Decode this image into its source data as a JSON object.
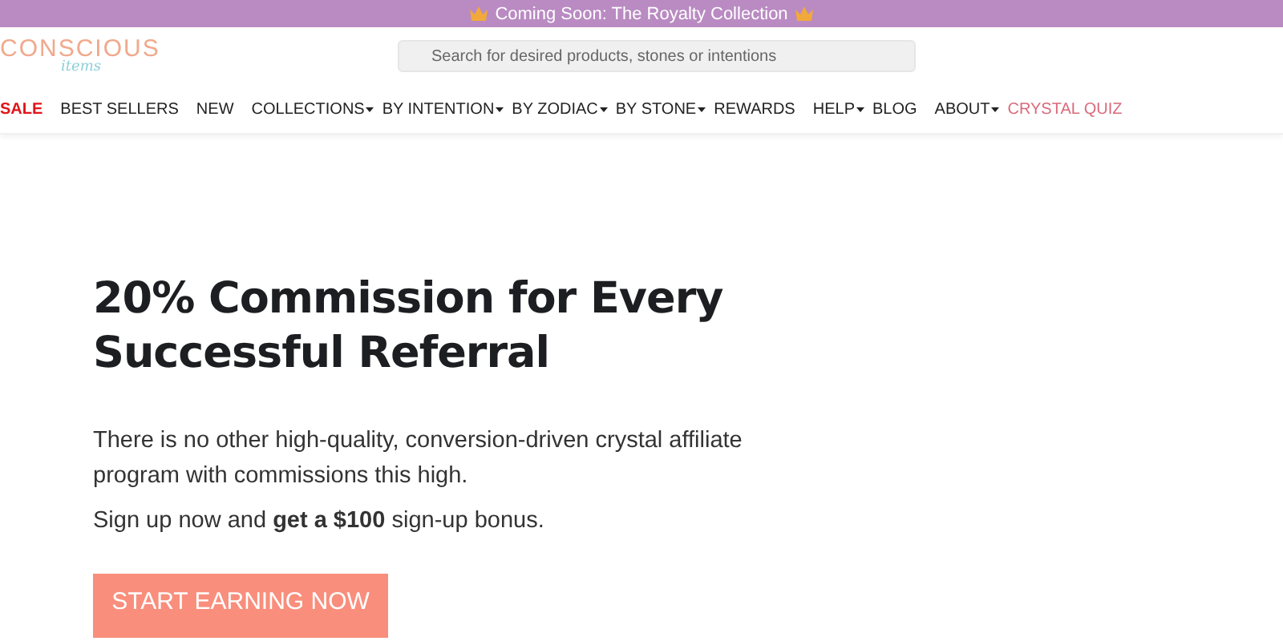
{
  "announcement": {
    "text": "Coming Soon: The Royalty Collection"
  },
  "logo": {
    "name": "CONSCIOUS",
    "tagline": "items"
  },
  "search": {
    "placeholder": "Search for desired products, stones or intentions"
  },
  "nav": [
    {
      "label": "SALE",
      "kind": "sale",
      "has_menu": false
    },
    {
      "label": "BEST SELLERS",
      "kind": "plain",
      "has_menu": false
    },
    {
      "label": "NEW",
      "kind": "plain",
      "has_menu": false
    },
    {
      "label": "COLLECTIONS",
      "kind": "plain",
      "has_menu": true
    },
    {
      "label": "BY INTENTION",
      "kind": "plain",
      "has_menu": true
    },
    {
      "label": "BY ZODIAC",
      "kind": "plain",
      "has_menu": true
    },
    {
      "label": "BY STONE",
      "kind": "plain",
      "has_menu": true
    },
    {
      "label": "REWARDS",
      "kind": "plain",
      "has_menu": false
    },
    {
      "label": "HELP",
      "kind": "plain",
      "has_menu": true
    },
    {
      "label": "BLOG",
      "kind": "plain",
      "has_menu": false
    },
    {
      "label": "ABOUT",
      "kind": "plain",
      "has_menu": true
    },
    {
      "label": "CRYSTAL QUIZ",
      "kind": "highlight",
      "has_menu": false
    }
  ],
  "hero": {
    "heading": "20% Commission for Every Successful Referral",
    "paragraphs": [
      "There is no other high-quality, conversion-driven crystal affiliate program with commissions this high.",
      "Sign up now and **get a $100** sign-up bonus."
    ],
    "button": "START EARNING NOW"
  }
}
